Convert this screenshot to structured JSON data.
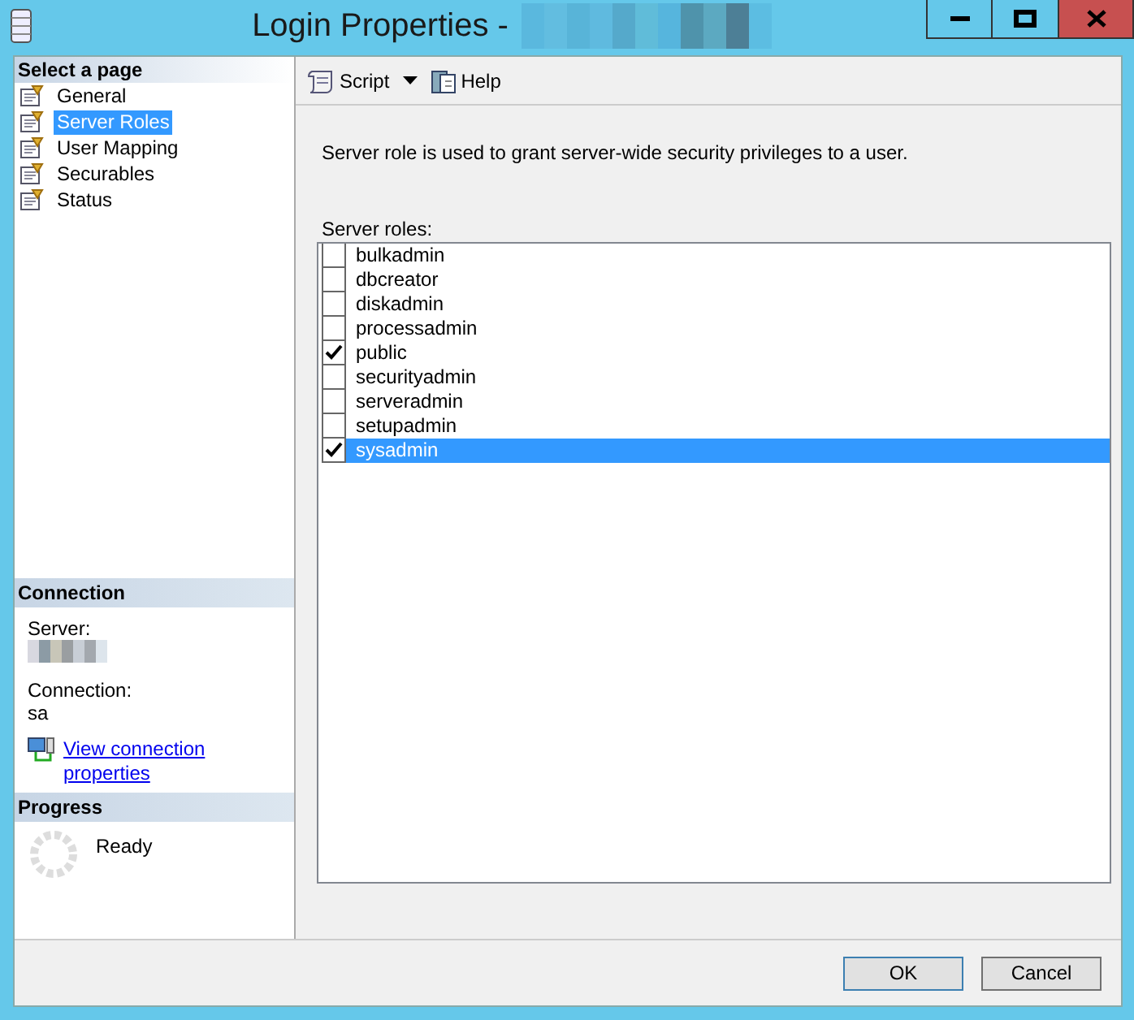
{
  "window": {
    "title": "Login Properties -"
  },
  "sidebar": {
    "header": "Select a page",
    "items": [
      {
        "label": "General",
        "selected": false
      },
      {
        "label": "Server Roles",
        "selected": true
      },
      {
        "label": "User Mapping",
        "selected": false
      },
      {
        "label": "Securables",
        "selected": false
      },
      {
        "label": "Status",
        "selected": false
      }
    ]
  },
  "connection": {
    "header": "Connection",
    "server_label": "Server:",
    "connection_label": "Connection:",
    "connection_value": "sa",
    "link": "View connection properties"
  },
  "progress": {
    "header": "Progress",
    "status": "Ready"
  },
  "toolbar": {
    "script": "Script",
    "help": "Help"
  },
  "description": "Server role is used to grant server-wide security privileges to a user.",
  "roles_label": "Server roles:",
  "roles": [
    {
      "name": "bulkadmin",
      "checked": false,
      "selected": false
    },
    {
      "name": "dbcreator",
      "checked": false,
      "selected": false
    },
    {
      "name": "diskadmin",
      "checked": false,
      "selected": false
    },
    {
      "name": "processadmin",
      "checked": false,
      "selected": false
    },
    {
      "name": "public",
      "checked": true,
      "selected": false
    },
    {
      "name": "securityadmin",
      "checked": false,
      "selected": false
    },
    {
      "name": "serveradmin",
      "checked": false,
      "selected": false
    },
    {
      "name": "setupadmin",
      "checked": false,
      "selected": false
    },
    {
      "name": "sysadmin",
      "checked": true,
      "selected": true
    }
  ],
  "buttons": [
    "OK",
    "Cancel"
  ]
}
